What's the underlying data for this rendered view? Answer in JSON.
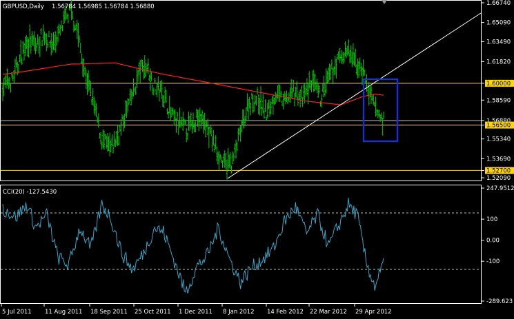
{
  "chart_data": [
    {
      "type": "candlestick",
      "title": "GBPUSD,Daily",
      "ohlc_readout": "1.56784 1.56985 1.56784 1.56880",
      "price_ticks": [
        "1.66740",
        "1.65090",
        "1.63490",
        "1.61820",
        "1.60000",
        "1.58590",
        "1.56880",
        "1.56500",
        "1.55340",
        "1.53690",
        "1.52700",
        "1.52090"
      ],
      "ylim": [
        1.5209,
        1.6674
      ],
      "x_ticks": [
        "5 Jul 2011",
        "11 Aug 2011",
        "18 Sep 2011",
        "25 Oct 2011",
        "1 Dec 2011",
        "8 Jan 2012",
        "14 Feb 2012",
        "22 Mar 2012",
        "29 Apr 2012"
      ],
      "bar_color": "#00cc00",
      "ma_color": "#ff2020",
      "horizontal_levels": [
        {
          "label": "1.60000",
          "value": 1.6,
          "color": "#ffd700"
        },
        {
          "label": "1.56500",
          "value": 1.565,
          "color": "#ffd700"
        },
        {
          "label": "1.52700",
          "value": 1.527,
          "color": "#ffd700"
        }
      ],
      "current_price": {
        "label": "1.56880",
        "value": 1.5688
      },
      "trendline": {
        "from": {
          "x": "8 Jan 2012",
          "y": 1.5209
        },
        "to": {
          "x": "beyond right edge",
          "y": 1.6674
        },
        "color": "#ffffff"
      },
      "highlight_box": {
        "color": "#1a2fd6"
      }
    },
    {
      "type": "line",
      "title": "CCI(20) -127.5430",
      "y_ticks": [
        "247.9512",
        "100",
        "0.00",
        "-100",
        "-289.623"
      ],
      "ylim": [
        -289.623,
        247.9512
      ],
      "dashed_levels": [
        100,
        -100
      ],
      "line_color": "#3aa6c8"
    }
  ]
}
